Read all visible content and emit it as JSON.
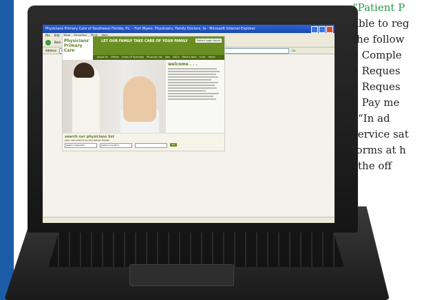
{
  "article": {
    "quote_open": "“Patient P",
    "line2": "able to reg",
    "line3": "the follow",
    "bullets": [
      "• Comple",
      "• Reques",
      "• Reques",
      "• Pay me"
    ],
    "line8": "“In ad",
    "line9": "service sat",
    "line10": "forms at h",
    "line11": "the off"
  },
  "browser": {
    "title": "Physicians Primary Care of Southwest Florida, P.L. - Fort Myers, Physicians, Family Doctors, fa - Microsoft Internet Explorer",
    "menu": [
      "File",
      "Edit",
      "View",
      "Favorites",
      "Tools",
      "Help"
    ],
    "toolbar": {
      "back": "Back",
      "search": "Search",
      "favorites": "Favorites"
    },
    "address_label": "Address",
    "address_value": "http://www.ppcswfl.com/",
    "go_label": "Go"
  },
  "site": {
    "logo_line1": "Physicians'",
    "logo_line2": "Primary",
    "logo_line3": "Care",
    "tagline": "LET OUR FAMILY TAKE CARE OF YOUR FAMILY",
    "login": "Patient Login  Home",
    "nav": [
      "About Us",
      "Offices",
      "Areas Of Specialty",
      "Physician list",
      "Jobs",
      "FAQ's",
      "What's New",
      "Links",
      "Home"
    ],
    "welcome": "welcome . . .",
    "search_title": "search our physicians list",
    "search_sub": "your can search by any option below:",
    "search_fields": [
      "Select a Specialty",
      "Select a Location",
      ""
    ],
    "search_go": "GO"
  },
  "colors": {
    "accent": "#6b8e23",
    "xp_blue": "#1c48b0",
    "edge": "#1d5da8"
  }
}
